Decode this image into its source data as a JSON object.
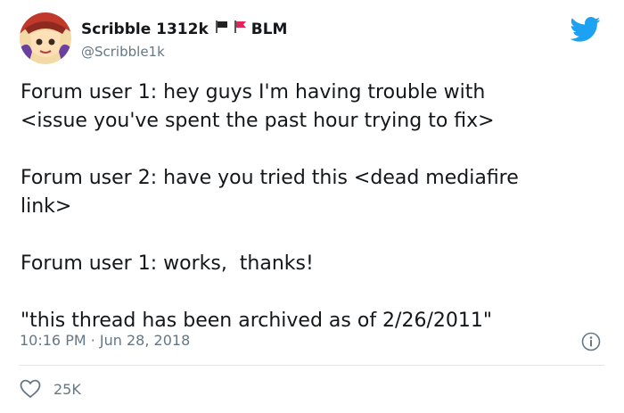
{
  "user": {
    "display_name": "Scribble 1312k",
    "flag_text": "BLM",
    "handle": "@Scribble1k"
  },
  "tweet": {
    "text": "Forum user 1: hey guys I'm having trouble with\n<issue you've spent the past hour trying to fix>\n\nForum user 2: have you tried this <dead mediafire\nlink>\n\nForum user 1: works,  thanks!\n\n\"this thread has been archived as of 2/26/2011\"",
    "timestamp": "10:16 PM · Jun 28, 2018"
  },
  "engagement": {
    "likes": "25K"
  },
  "icons": {
    "logo": "twitter-bird-icon",
    "info": "info-icon",
    "like": "heart-icon",
    "flag_black": "black-flag-icon",
    "flag_red": "red-flag-icon"
  },
  "colors": {
    "brand": "#1da1f2",
    "text": "#14171a",
    "muted": "#657786",
    "divider": "#e1e8ed"
  }
}
